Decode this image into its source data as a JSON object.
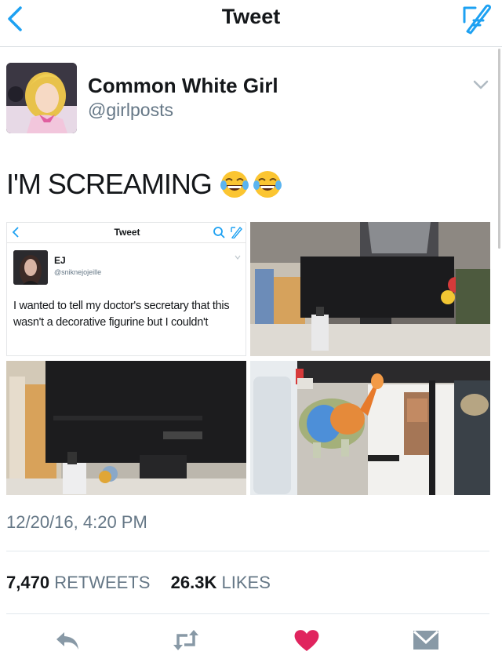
{
  "navbar": {
    "title": "Tweet"
  },
  "author": {
    "name": "Common White Girl",
    "handle": "@girlposts"
  },
  "tweet": {
    "text": "I'M SCREAMING",
    "emoji": [
      "face-with-tears-of-joy",
      "face-with-tears-of-joy"
    ]
  },
  "embedded": {
    "title": "Tweet",
    "name": "EJ",
    "handle": "@sniknejojeille",
    "text": "I wanted to tell my doctor's secretary that this wasn't a decorative figurine but I couldn't"
  },
  "timestamp": "12/20/16, 4:20 PM",
  "stats": {
    "retweets": "7,470",
    "retweets_label": "RETWEETS",
    "likes": "26.3K",
    "likes_label": "LIKES"
  },
  "colors": {
    "accent": "#1da1f2",
    "like": "#e0245e",
    "secondary": "#657786",
    "icon": "#8899a6"
  }
}
